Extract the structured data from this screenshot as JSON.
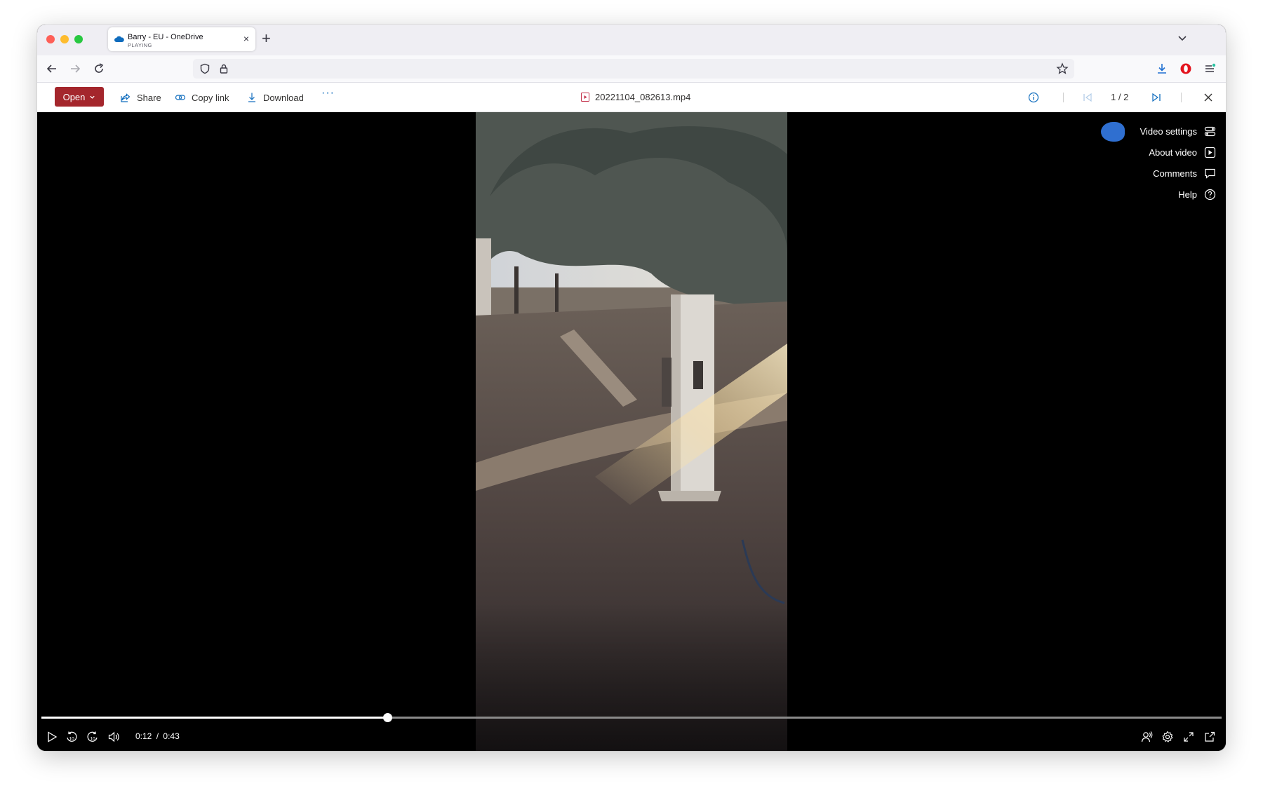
{
  "browser": {
    "tab": {
      "title": "Barry - EU - OneDrive",
      "subtitle": "PLAYING",
      "close": "×"
    },
    "new_tab": "+"
  },
  "command_bar": {
    "open_label": "Open",
    "share_label": "Share",
    "copy_link_label": "Copy link",
    "download_label": "Download",
    "more_label": "···",
    "file_name": "20221104_082613.mp4",
    "counter": "1 / 2"
  },
  "side_menu": {
    "items": [
      {
        "label": "Video settings",
        "icon": "video-settings-icon"
      },
      {
        "label": "About video",
        "icon": "about-video-icon"
      },
      {
        "label": "Comments",
        "icon": "comment-icon"
      },
      {
        "label": "Help",
        "icon": "help-icon"
      }
    ]
  },
  "player": {
    "current_time": "0:12",
    "separator": "/",
    "duration": "0:43",
    "progress_fraction": 0.293,
    "state": "paused"
  },
  "colors": {
    "open_button": "#a4262c",
    "accent": "#0f6cbd",
    "blue_dot": "#2f6fd0"
  }
}
